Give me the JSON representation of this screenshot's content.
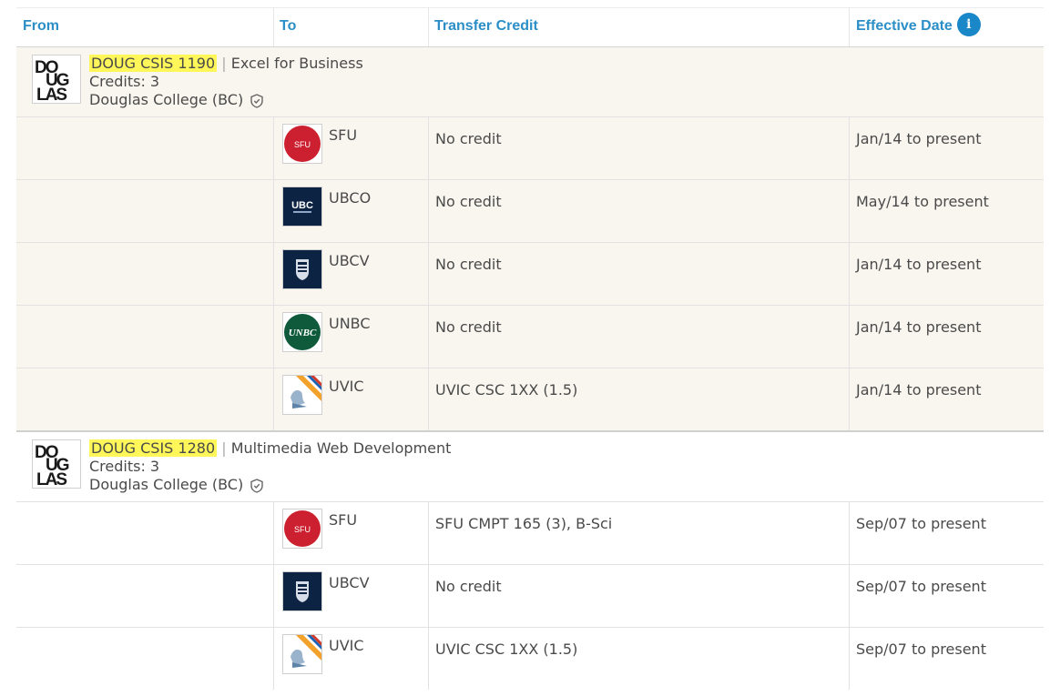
{
  "headers": {
    "from": "From",
    "to": "To",
    "transfer_credit": "Transfer Credit",
    "effective_date": "Effective Date",
    "info_icon": "i"
  },
  "courses": [
    {
      "logo_text": "DOUGLAS",
      "code": "DOUG CSIS 1190",
      "separator": "|",
      "title": "Excel for Business",
      "credits": "Credits: 3",
      "institution": "Douglas College (BC)",
      "rows": [
        {
          "inst": "SFU",
          "logo": "SFU",
          "credit": "No credit",
          "date": "Jan/14 to present"
        },
        {
          "inst": "UBCO",
          "logo": "UBC",
          "credit": "No credit",
          "date": "May/14 to present"
        },
        {
          "inst": "UBCV",
          "logo": "UBC",
          "credit": "No credit",
          "date": "Jan/14 to present"
        },
        {
          "inst": "UNBC",
          "logo": "UNBC",
          "credit": "No credit",
          "date": "Jan/14 to present"
        },
        {
          "inst": "UVIC",
          "logo": "",
          "credit": "UVIC CSC 1XX (1.5)",
          "date": "Jan/14 to present"
        }
      ]
    },
    {
      "logo_text": "DOUGLAS",
      "code": "DOUG CSIS 1280",
      "separator": "|",
      "title": "Multimedia Web Development",
      "credits": "Credits: 3",
      "institution": "Douglas College (BC)",
      "rows": [
        {
          "inst": "SFU",
          "logo": "SFU",
          "credit": "SFU CMPT 165 (3), B-Sci",
          "date": "Sep/07 to present"
        },
        {
          "inst": "UBCV",
          "logo": "UBC",
          "credit": "No credit",
          "date": "Sep/07 to present"
        },
        {
          "inst": "UVIC",
          "logo": "",
          "credit": "UVIC CSC 1XX (1.5)",
          "date": "Sep/07 to present"
        }
      ]
    }
  ],
  "colors": {
    "header_text": "#2b8ec7",
    "highlight": "#fff75a",
    "shaded_row": "#f8f6ef",
    "sfu_red": "#cc1f2f",
    "ubc_navy": "#0c2344",
    "unbc_green": "#0e5a3a"
  }
}
